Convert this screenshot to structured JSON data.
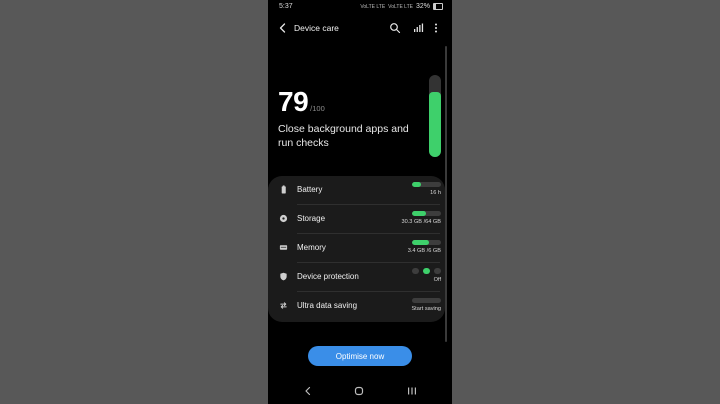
{
  "status": {
    "time": "5:37",
    "signal1": "VoLTE LTE",
    "signal2": "VoLTE LTE",
    "battery": "32%"
  },
  "header": {
    "title": "Device care"
  },
  "score": {
    "value": "79",
    "max": "/100",
    "level": 0.79
  },
  "subtitle": "Close background apps and run checks",
  "rows": [
    {
      "label": "Battery",
      "value": "16 h",
      "fill": 0.32,
      "icon": "battery-icon"
    },
    {
      "label": "Storage",
      "value": "30.3 GB /64 GB",
      "fill": 0.47,
      "icon": "storage-icon"
    },
    {
      "label": "Memory",
      "value": "3.4 GB /6 GB",
      "fill": 0.57,
      "icon": "memory-icon"
    },
    {
      "label": "Device protection",
      "value": "Off",
      "icon": "shield-icon"
    },
    {
      "label": "Ultra data saving",
      "value": "Start saving",
      "fill": 0,
      "icon": "data-saving-icon"
    }
  ],
  "optimise_label": "Optimise now",
  "colors": {
    "accent_green": "#3ed06b",
    "button_blue": "#3a8ee8"
  }
}
